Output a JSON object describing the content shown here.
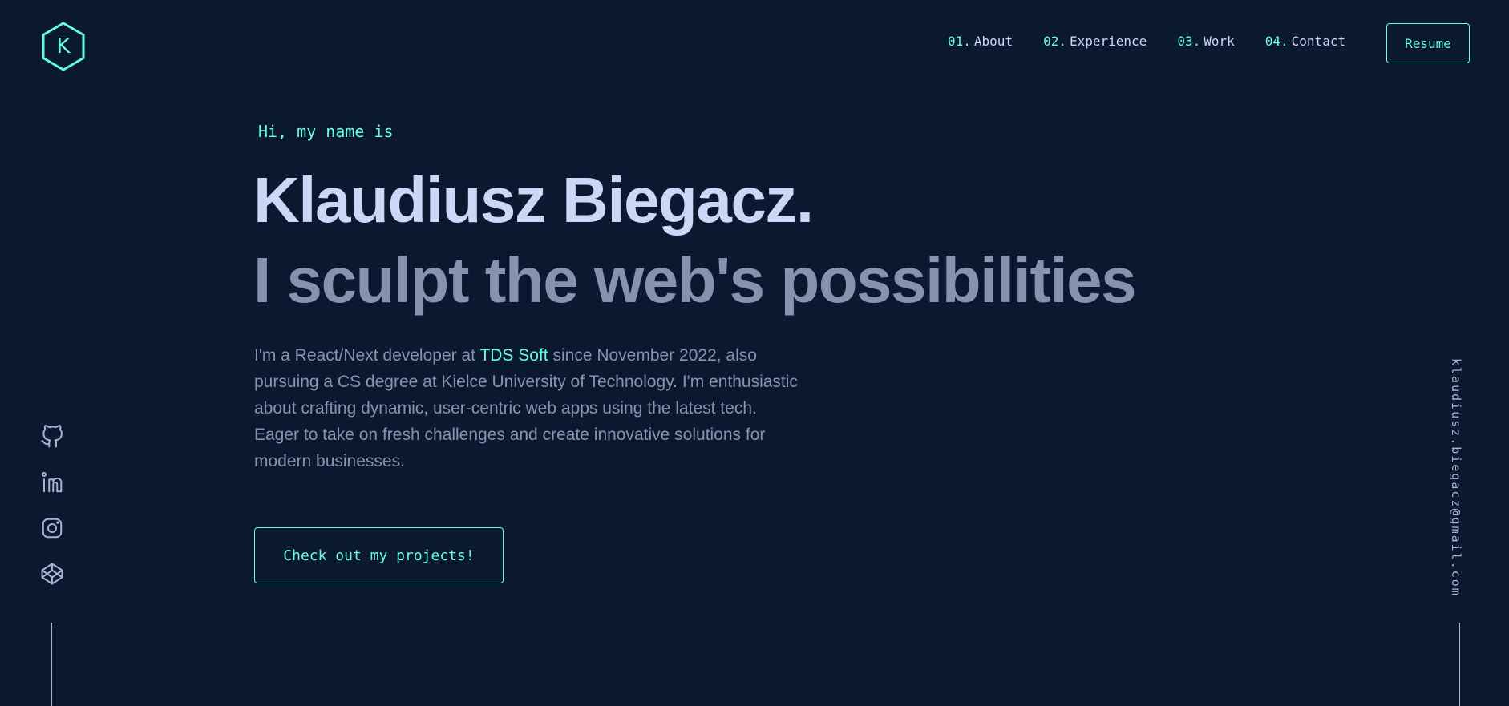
{
  "brand": {
    "logo_letter": "K"
  },
  "nav": {
    "items": [
      {
        "num": "01.",
        "label": "About"
      },
      {
        "num": "02.",
        "label": "Experience"
      },
      {
        "num": "03.",
        "label": "Work"
      },
      {
        "num": "04.",
        "label": "Contact"
      }
    ],
    "resume_label": "Resume"
  },
  "hero": {
    "intro": "Hi, my name is",
    "name": "Klaudiusz Biegacz.",
    "tagline": "I sculpt the web's possibilities",
    "bio": {
      "before_company": "I'm a React/Next developer at ",
      "company": "TDS Soft",
      "after_company": " since November 2022, also pursuing a CS degree at Kielce University of Technology. I'm enthusiastic about crafting dynamic, user-centric web apps using the latest tech. Eager to take on fresh challenges and create innovative solutions for modern businesses."
    },
    "cta_label": "Check out my projects!"
  },
  "social": {
    "icons": [
      "github-icon",
      "linkedin-icon",
      "instagram-icon",
      "codepen-icon"
    ]
  },
  "email": "klaudiusz.biegacz@gmail.com",
  "colors": {
    "background": "#0a192f",
    "accent": "#64ffda",
    "heading": "#ccd6f6",
    "body": "#8892b0",
    "rail": "#a8b2d1"
  }
}
